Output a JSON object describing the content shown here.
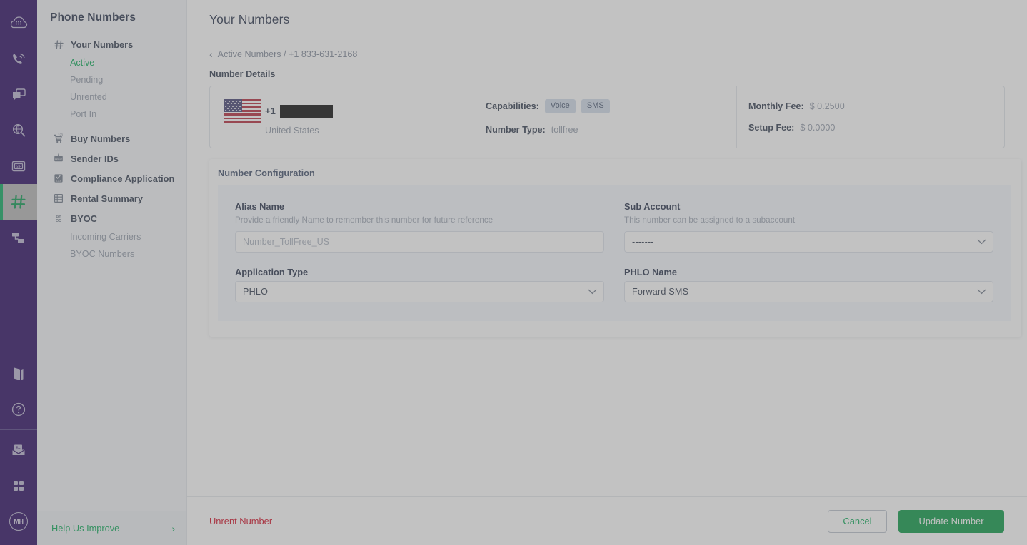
{
  "icon_rail": {
    "items": [
      {
        "name": "cloud-dialpad-icon",
        "label": "Cloud"
      },
      {
        "name": "phone-voice-icon",
        "label": "Voice"
      },
      {
        "name": "messaging-icon",
        "label": "Messaging"
      },
      {
        "name": "lookup-search-icon",
        "label": "Lookup"
      },
      {
        "name": "sip-trunk-icon",
        "label": "SIP Trunking"
      },
      {
        "name": "phone-numbers-icon",
        "label": "Phone Numbers"
      },
      {
        "name": "network-flow-icon",
        "label": "PHLO"
      }
    ],
    "bottom_items": [
      {
        "name": "docs-book-icon",
        "label": "Docs"
      },
      {
        "name": "help-question-icon",
        "label": "Help"
      },
      {
        "name": "billing-envelope-icon",
        "label": "Billing"
      },
      {
        "name": "apps-grid-icon",
        "label": "Apps"
      }
    ],
    "avatar_initials": "MH"
  },
  "sidebar": {
    "title": "Phone Numbers",
    "groups": [
      {
        "icon": "hash-icon",
        "label": "Your Numbers",
        "children": [
          {
            "label": "Active",
            "active": true
          },
          {
            "label": "Pending",
            "active": false
          },
          {
            "label": "Unrented",
            "active": false
          },
          {
            "label": "Port In",
            "active": false
          }
        ]
      },
      {
        "icon": "cart-123-icon",
        "label": "Buy Numbers",
        "children": []
      },
      {
        "icon": "sender-id-icon",
        "label": "Sender IDs",
        "children": []
      },
      {
        "icon": "compliance-123-icon",
        "label": "Compliance Application",
        "children": []
      },
      {
        "icon": "table-grid-icon",
        "label": "Rental Summary",
        "children": []
      },
      {
        "icon": "byoc-icon",
        "label": "BYOC",
        "children": [
          {
            "label": "Incoming Carriers",
            "active": false
          },
          {
            "label": "BYOC Numbers",
            "active": false
          }
        ]
      }
    ],
    "footer": {
      "label": "Help Us Improve",
      "arrow": "›"
    }
  },
  "header": {
    "title": "Your Numbers"
  },
  "breadcrumb": {
    "chevron": "‹",
    "text": "Active Numbers / +1 833-631-2168"
  },
  "number_details": {
    "section_label": "Number Details",
    "country_code": "+1",
    "number_masked": "",
    "country": "United States",
    "capabilities_label": "Capabilities:",
    "capabilities": [
      "Voice",
      "SMS"
    ],
    "number_type_label": "Number Type:",
    "number_type_value": "tollfree",
    "monthly_fee_label": "Monthly Fee:",
    "monthly_fee_value": "$ 0.2500",
    "setup_fee_label": "Setup Fee:",
    "setup_fee_value": "$ 0.0000"
  },
  "number_configuration": {
    "title": "Number Configuration",
    "alias": {
      "label": "Alias Name",
      "hint": "Provide a friendly Name to remember this number for future reference",
      "value": "",
      "placeholder": "Number_TollFree_US"
    },
    "sub_account": {
      "label": "Sub Account",
      "hint": "This number can be assigned to a subaccount",
      "value": "-------"
    },
    "application_type": {
      "label": "Application Type",
      "value": "PHLO"
    },
    "phlo_name": {
      "label": "PHLO Name",
      "value": "Forward SMS"
    }
  },
  "footer_bar": {
    "unrent_label": "Unrent Number",
    "cancel_label": "Cancel",
    "update_label": "Update Number"
  },
  "colors": {
    "rail_bg": "#21005c",
    "accent_green": "#00a651",
    "primary_button": "#00953f",
    "danger_red": "#d0021b",
    "badge_bg": "#cfdaea",
    "panel_bg": "#f5f8fd"
  }
}
